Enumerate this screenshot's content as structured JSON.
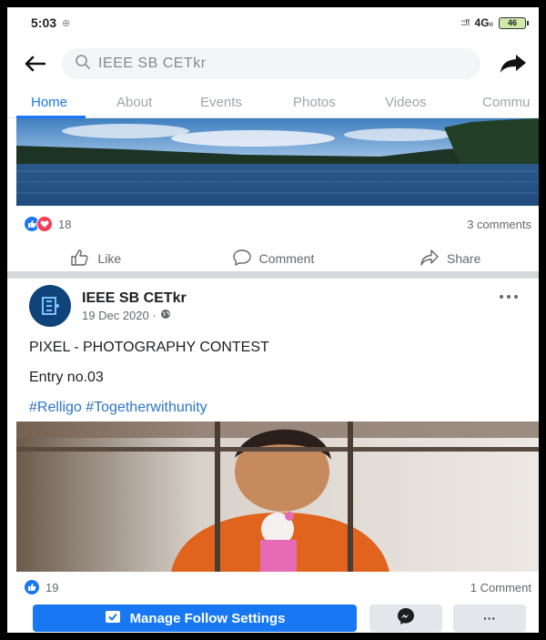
{
  "status_bar": {
    "time": "5:03",
    "sim_indicator": "⊕",
    "signal_text": "::!!",
    "network": "4G",
    "network_suffix": "ıı",
    "battery": "46"
  },
  "search": {
    "value": "IEEE SB CETkr",
    "icon": "search-icon"
  },
  "tabs": [
    "Home",
    "About",
    "Events",
    "Photos",
    "Videos",
    "Commu"
  ],
  "active_tab": "Home",
  "post1": {
    "reaction_count": "18",
    "comments": "3 comments",
    "actions": {
      "like": "Like",
      "comment": "Comment",
      "share": "Share"
    }
  },
  "post2": {
    "author": "IEEE SB CETkr",
    "date": "19 Dec 2020 ·",
    "privacy_icon": "globe-icon",
    "line1": "PIXEL - PHOTOGRAPHY CONTEST",
    "line2": "Entry no.03",
    "hashtags": "#Relligo #Togetherwithunity",
    "reaction_count": "19",
    "comments": "1 Comment"
  },
  "follow_bar": {
    "manage_label": "Manage Follow Settings",
    "more_label": "···"
  },
  "colors": {
    "brand_blue": "#1877f2",
    "link_blue": "#2d74c4",
    "love_red": "#f33e58",
    "tab_inactive": "#a0a4ab"
  }
}
